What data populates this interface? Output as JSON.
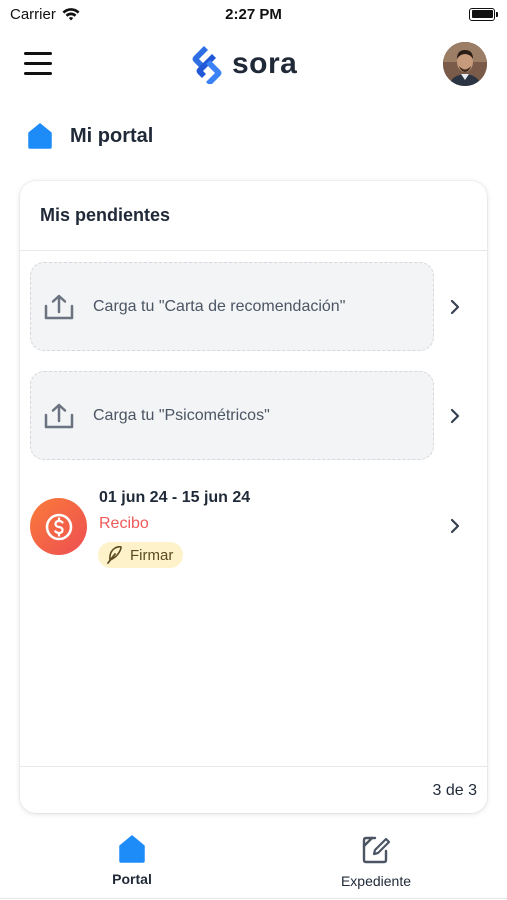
{
  "status_bar": {
    "carrier": "Carrier",
    "time": "2:27 PM"
  },
  "header": {
    "logo_text": "sora",
    "brand_color": "#2563eb"
  },
  "page": {
    "title": "Mi portal",
    "accent_color": "#1d8cf8"
  },
  "pendientes": {
    "title": "Mis pendientes",
    "uploads": [
      {
        "label": "Carga tu \"Carta de recomendación\"",
        "icon": "upload-icon"
      },
      {
        "label": "Carga tu \"Psicométricos\"",
        "icon": "upload-icon"
      }
    ],
    "receipt": {
      "date_range": "01 jun 24 - 15 jun 24",
      "type": "Recibo",
      "action": "Firmar",
      "icon": "dollar-coin-icon"
    },
    "pagination": "3 de 3"
  },
  "bottom_nav": {
    "tabs": [
      {
        "label": "Portal",
        "icon": "home-icon",
        "active": true
      },
      {
        "label": "Expediente",
        "icon": "document-edit-icon",
        "active": false
      }
    ]
  }
}
